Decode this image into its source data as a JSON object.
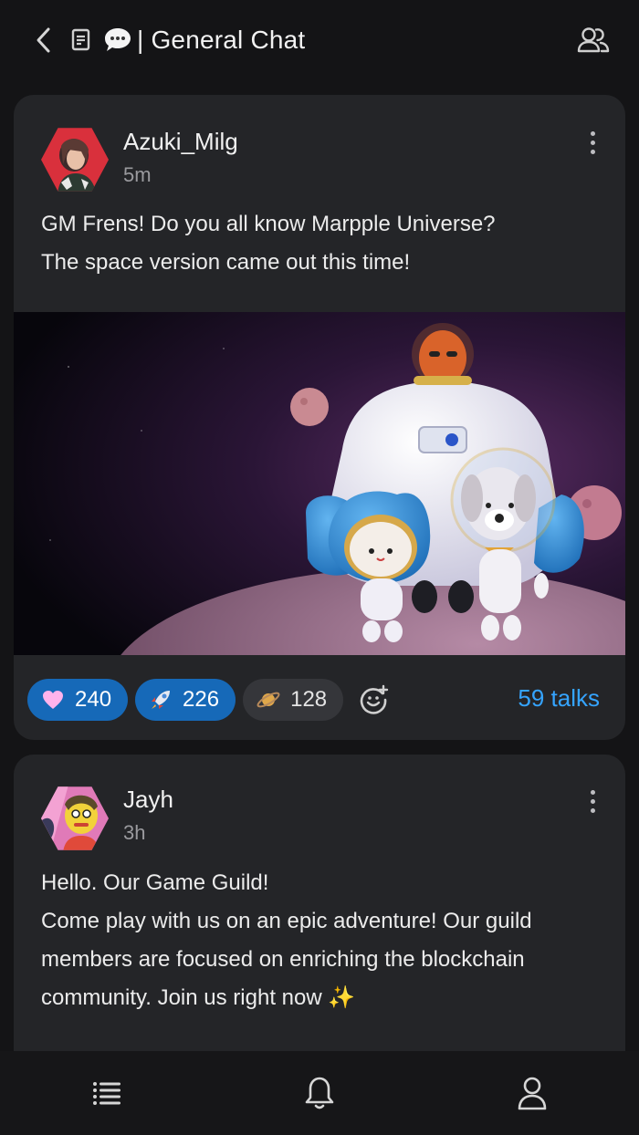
{
  "header": {
    "title": "| General Chat",
    "icons": [
      "back-icon",
      "document-icon",
      "chat-bubble-icon",
      "members-icon"
    ]
  },
  "posts": [
    {
      "author": "Azuki_Milg",
      "time": "5m",
      "text": "GM Frens! Do you all know Marpple Universe?\nThe space version came out this time!",
      "reactions": [
        {
          "icon": "heart-icon",
          "count": "240",
          "active": true,
          "color": "#ff7ad9"
        },
        {
          "icon": "rocket-icon",
          "count": "226",
          "active": true
        },
        {
          "icon": "planet-icon",
          "count": "128",
          "active": false
        }
      ],
      "talks": "59 talks"
    },
    {
      "author": "Jayh",
      "time": "3h",
      "text": "Hello. Our Game Guild!\nCome play with us on an epic adventure! Our guild members are focused on enriching the blockchain community. Join us right now ✨"
    }
  ],
  "bottom_nav": [
    "list-icon",
    "bell-icon",
    "profile-icon"
  ],
  "colors": {
    "background": "#141416",
    "card": "#242528",
    "accent": "#1669b8",
    "link": "#35a4ff"
  }
}
